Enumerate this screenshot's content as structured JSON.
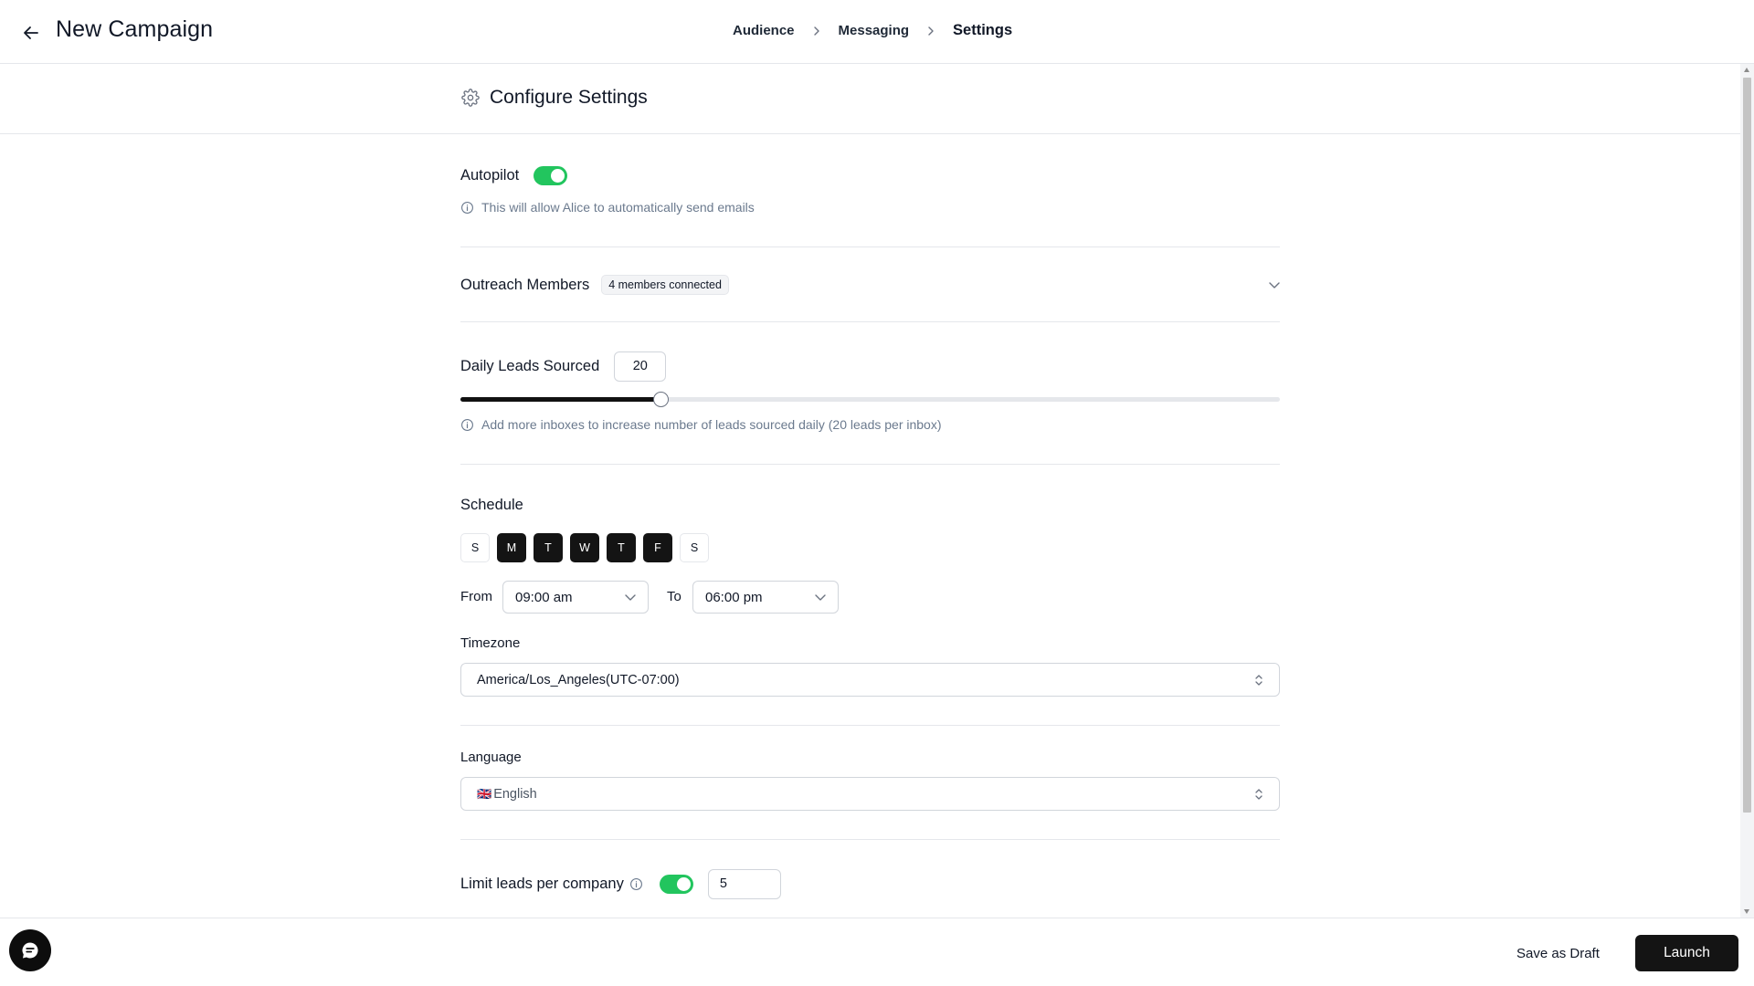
{
  "header": {
    "title": "New Campaign",
    "steps": [
      {
        "label": "Audience"
      },
      {
        "label": "Messaging"
      },
      {
        "label": "Settings"
      }
    ]
  },
  "section": {
    "title": "Configure Settings"
  },
  "autopilot": {
    "label": "Autopilot",
    "enabled": true,
    "hint": "This will allow Alice to automatically send emails"
  },
  "outreach": {
    "label": "Outreach Members",
    "badge": "4 members connected"
  },
  "daily_leads": {
    "label": "Daily Leads Sourced",
    "value": "20",
    "slider_fraction": 0.245,
    "hint": "Add more inboxes to increase number of leads sourced daily (20 leads per inbox)"
  },
  "schedule": {
    "label": "Schedule",
    "days": [
      {
        "letter": "S",
        "active": false
      },
      {
        "letter": "M",
        "active": true
      },
      {
        "letter": "T",
        "active": true
      },
      {
        "letter": "W",
        "active": true
      },
      {
        "letter": "T",
        "active": true
      },
      {
        "letter": "F",
        "active": true
      },
      {
        "letter": "S",
        "active": false
      }
    ],
    "from_label": "From",
    "from_value": "09:00 am",
    "to_label": "To",
    "to_value": "06:00 pm"
  },
  "timezone": {
    "label": "Timezone",
    "value": "America/Los_Angeles(UTC-07:00)"
  },
  "language": {
    "label": "Language",
    "flag": "🇬🇧",
    "value": "English"
  },
  "limit_leads": {
    "label": "Limit leads per company",
    "enabled": true,
    "value": "5"
  },
  "footer": {
    "draft_label": "Save as Draft",
    "launch_label": "Launch"
  },
  "colors": {
    "accent_green": "#22c55e",
    "primary_dark": "#141414",
    "muted_text": "#6b7a8e"
  }
}
